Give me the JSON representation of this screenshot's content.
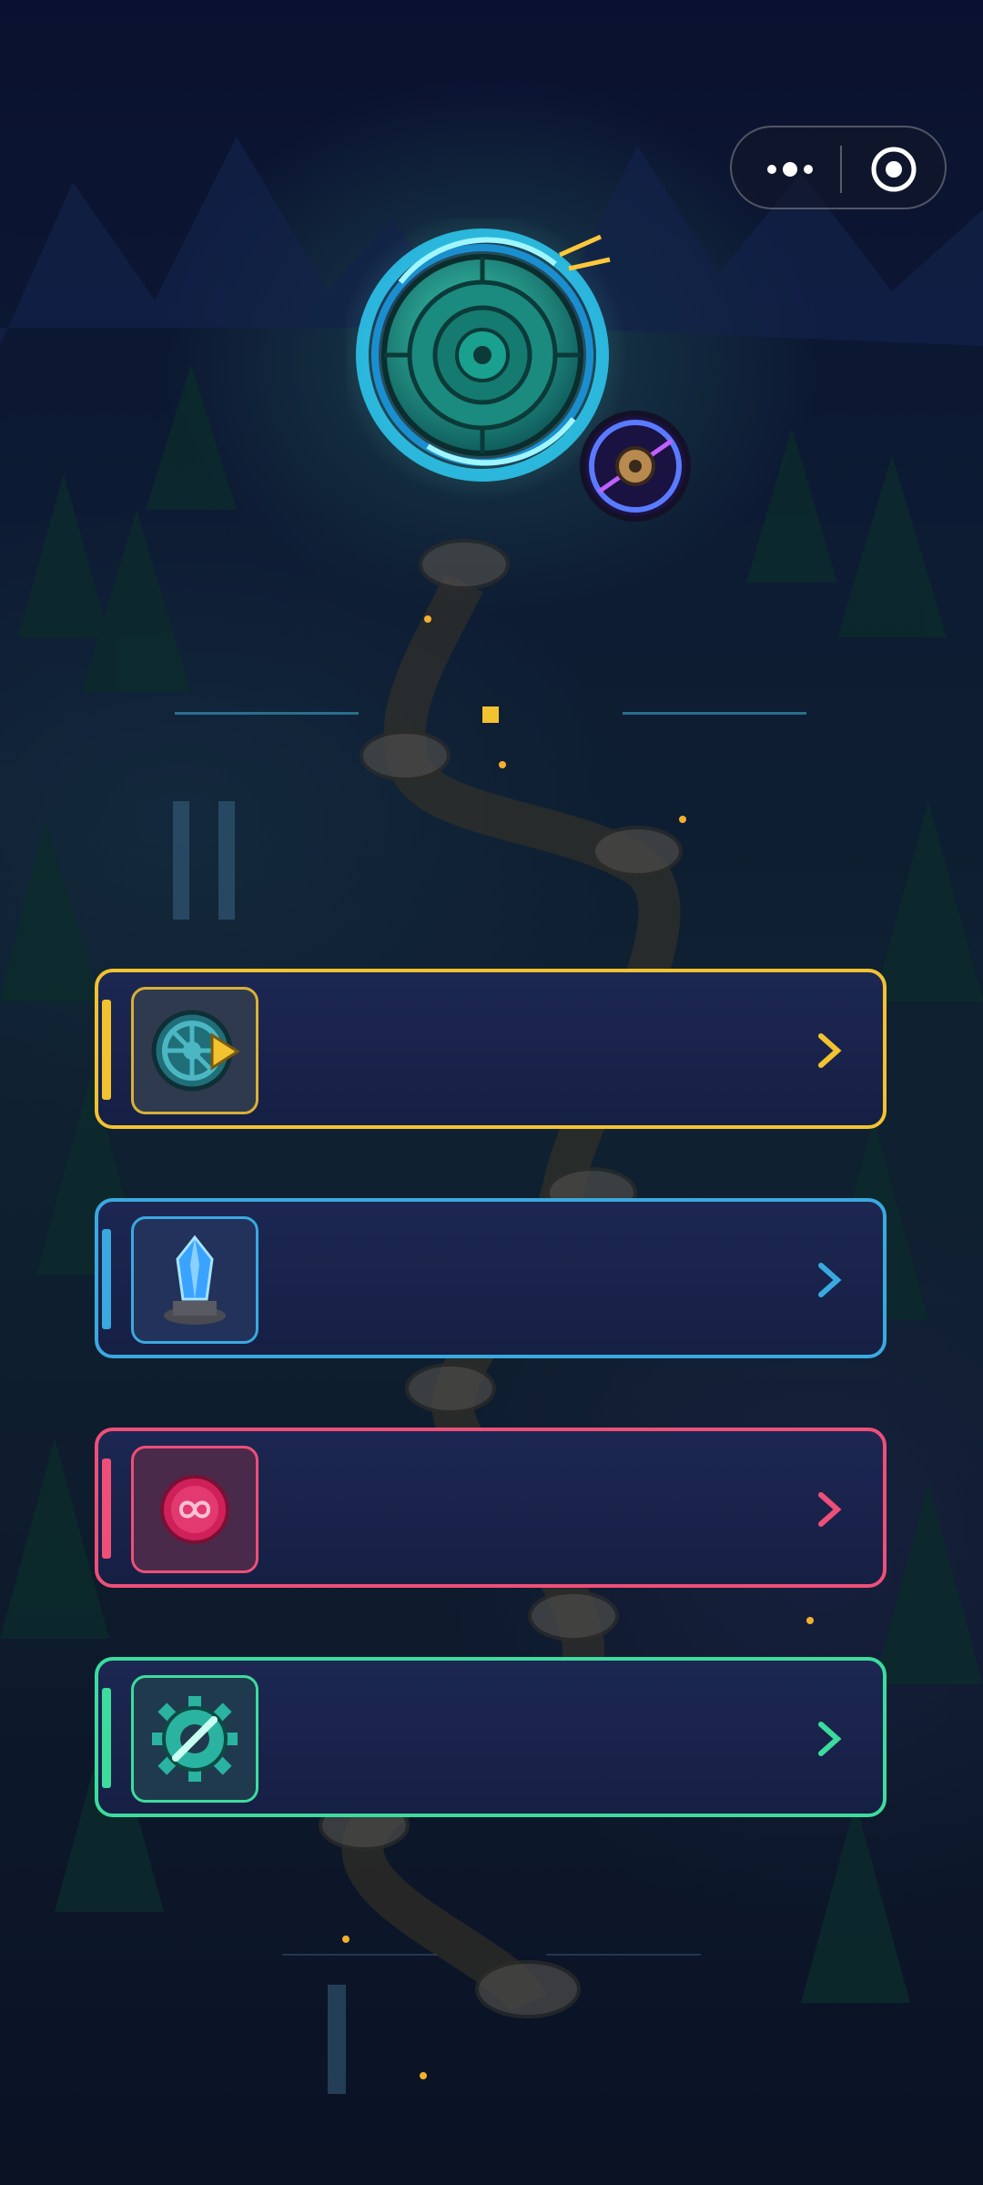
{
  "capsule": {
    "more_icon": "more-dots-icon",
    "close_icon": "target-close-icon"
  },
  "emblem": {
    "icon": "vault-portal-icon",
    "badge_icon": "compass-star-badge-icon"
  },
  "colors": {
    "yellow": "#f2c230",
    "blue": "#3aa9e0",
    "pink": "#ee4f78",
    "green": "#3ddc9d"
  },
  "menu": [
    {
      "label": "",
      "icon": "wheel-play-icon",
      "accent": "#f2c230"
    },
    {
      "label": "",
      "icon": "crystal-pedestal-icon",
      "accent": "#3aa9e0"
    },
    {
      "label": "",
      "icon": "infinity-orb-icon",
      "accent": "#ee4f78"
    },
    {
      "label": "",
      "icon": "gear-wrench-icon",
      "accent": "#3ddc9d"
    }
  ]
}
